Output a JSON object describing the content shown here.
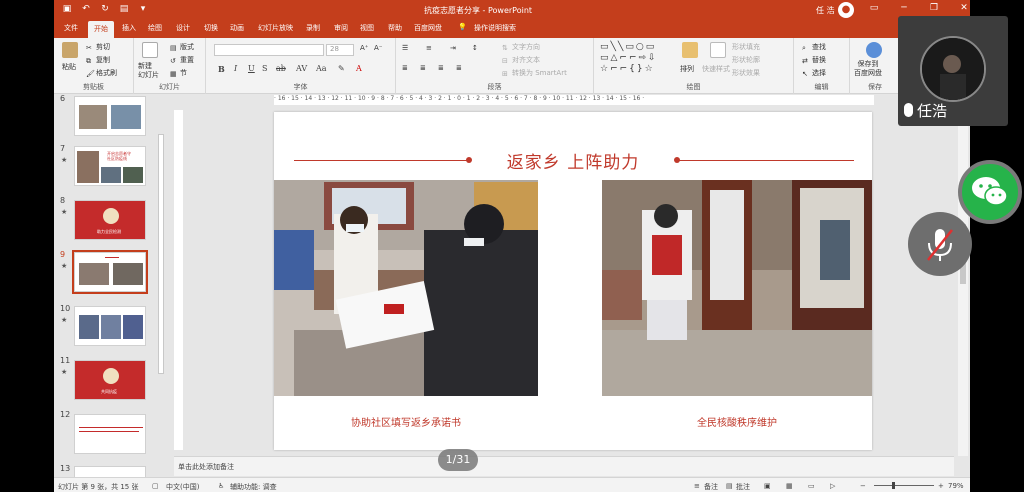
{
  "window": {
    "doc_title": "抗疫志愿者分享  -  PowerPoint",
    "user_name": "任 浩",
    "user_avatar_icon": "person-icon",
    "accent": "#c43e1c"
  },
  "tabs": [
    "文件",
    "开始",
    "插入",
    "绘图",
    "设计",
    "切换",
    "动画",
    "幻灯片放映",
    "录制",
    "审阅",
    "视图",
    "帮助",
    "百度网盘",
    "操作说明搜索"
  ],
  "ribbon": {
    "paste": "粘贴",
    "cut": "剪切",
    "copy": "复制",
    "format_painter": "格式刷",
    "clipboard": "剪贴板",
    "new_slide": "新建\n幻灯片",
    "layout": "版式",
    "reset": "重置",
    "section": "节",
    "slides": "幻灯片",
    "font": "字体",
    "text_direction": "文字方向",
    "align_text": "对齐文本",
    "convert_smartart": "转换为 SmartArt",
    "paragraph": "段落",
    "arrange": "排列",
    "quick_styles": "快速样式",
    "shape_fill": "形状填充",
    "shape_outline": "形状轮廓",
    "shape_effects": "形状效果",
    "drawing": "绘图",
    "find": "查找",
    "replace": "替换",
    "select": "选择",
    "editing": "编辑",
    "save_to_baidu": "保存到\n百度网盘",
    "save": "保存",
    "font_size": "28"
  },
  "thumbnails": [
    {
      "num": "6",
      "star": "",
      "style": "photos"
    },
    {
      "num": "7",
      "star": "★",
      "style": "photos-text",
      "text": "开启志愿者守\n社区防疫线"
    },
    {
      "num": "8",
      "star": "★",
      "style": "red",
      "text": "助力全民检测"
    },
    {
      "num": "9",
      "star": "★",
      "style": "selected"
    },
    {
      "num": "10",
      "star": "★",
      "style": "photos"
    },
    {
      "num": "11",
      "star": "★",
      "style": "red",
      "text": "共同抗疫"
    },
    {
      "num": "12",
      "star": "",
      "style": "text"
    },
    {
      "num": "13",
      "star": "",
      "style": "blank"
    }
  ],
  "ruler": "· 16 · 15 · 14 · 13 · 12 · 11 · 10 · 9 · 8 · 7 · 6 · 5 · 4 · 3 · 2 · 1 · 0 · 1 · 2 · 3 · 4 · 5 · 6 · 7 · 8 · 9 · 10 · 11 · 12 · 13 · 14 · 15 · 16 ·",
  "slide": {
    "title": "返家乡 上阵助力",
    "caption_left": "协助社区填写返乡承诺书",
    "caption_right": "全民核酸秩序维护",
    "title_color": "#c0392b"
  },
  "notes_placeholder": "单击此处添加备注",
  "page_indicator": "1/31",
  "status": {
    "slide_info": "幻灯片 第 9 张，共 15 张",
    "language": "中文(中国)",
    "accessibility": "辅助功能: 调查",
    "notes": "备注",
    "comments": "批注",
    "zoom": "79%"
  },
  "call": {
    "participant_name": "任浩",
    "wechat_icon": "wechat-icon",
    "mic_muted_icon": "mic-muted-icon"
  }
}
